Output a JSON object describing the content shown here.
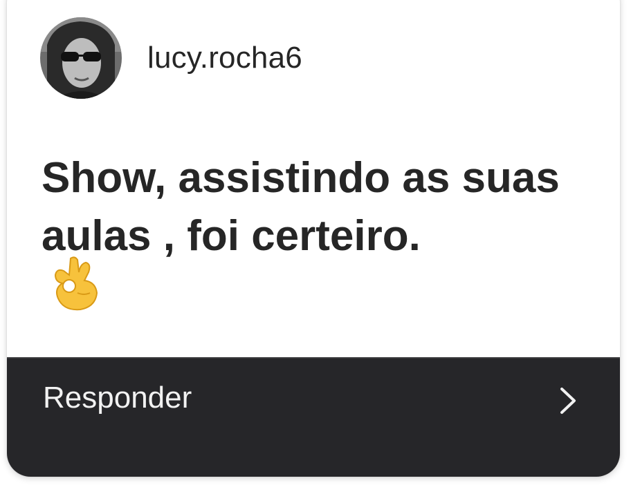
{
  "comment": {
    "username": "lucy.rocha6",
    "avatar_icon": "profile-photo",
    "text": "Show, assistindo as suas aulas , foi certeiro.",
    "emoji_icon": "ok-hand-emoji"
  },
  "reply": {
    "label": "Responder",
    "icon": "chevron-right-icon"
  },
  "colors": {
    "text": "#262626",
    "reply_bar": "#262629",
    "reply_text": "#f2f2f2"
  }
}
